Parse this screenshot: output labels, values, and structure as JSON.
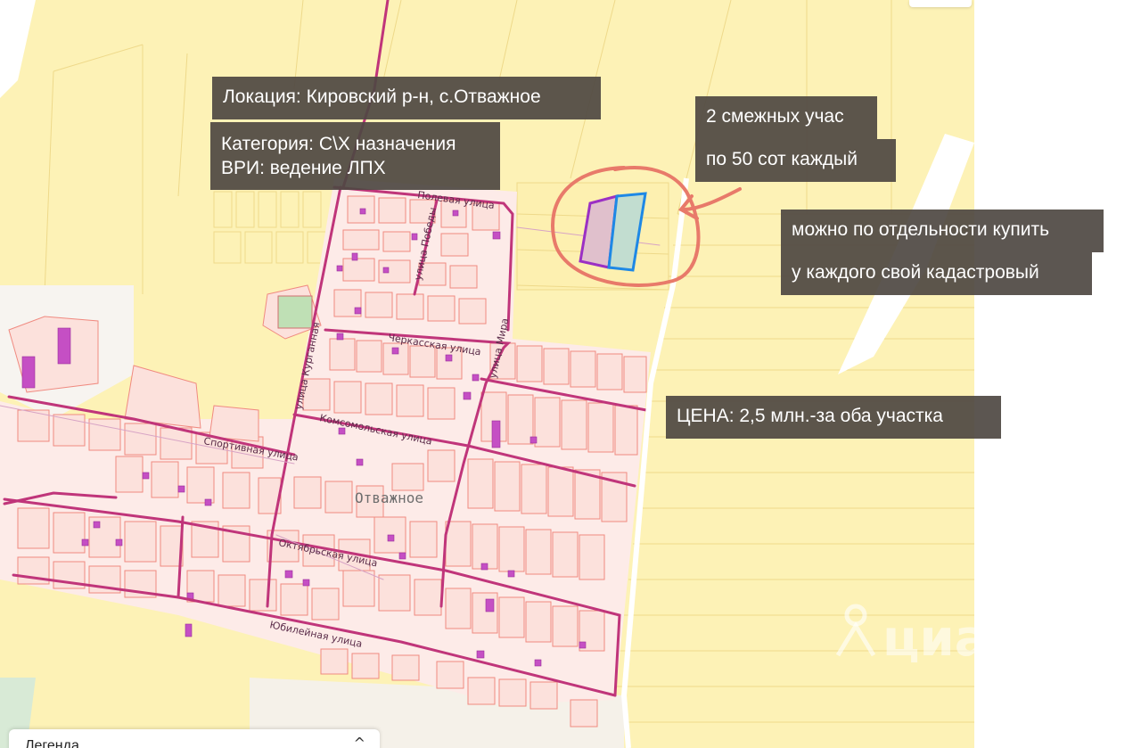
{
  "map": {
    "village_label": "Отважное",
    "streets": {
      "polevaya": "Полевая улица",
      "pobedy": "улица Победы",
      "kurgannaya": "улица Курганная",
      "cherkasskaya": "Черкасская улица",
      "mira": "улица Мира",
      "komsomolskaya": "Комсомольская улица",
      "sportivnaya": "Спортивная улица",
      "oktyabrskaya": "Октябрьская улица",
      "yubileynaya": "Юбилейная улица"
    },
    "watermark": "циан"
  },
  "annotations": {
    "location": "Локация: Кировский р-н, с.Отважное",
    "category_line1": "Категория: С\\Х назначения",
    "category_line2": "ВРИ: ведение ЛПХ",
    "plots_line1": "2 смежных учас",
    "plots_line2": "по 50 сот каждый",
    "separate_line1": "можно по отдельности купить",
    "separate_line2": "у каждого свой кадастровый",
    "price": "ЦЕНА: 2,5 млн.-за оба участка"
  },
  "legend": {
    "label": "Легенда",
    "toggle_icon": "chevron-up-icon"
  },
  "colors": {
    "farmland": "#fdf2b6",
    "parcel_fill": "#fce1dc",
    "parcel_stroke": "#f08a80",
    "road": "#c0357a",
    "building": "#c54fc4",
    "annotation_bg": "#4e4842",
    "circle": "#e87a6a",
    "plot_left": "#9b30c4",
    "plot_right": "#1e88e5"
  }
}
